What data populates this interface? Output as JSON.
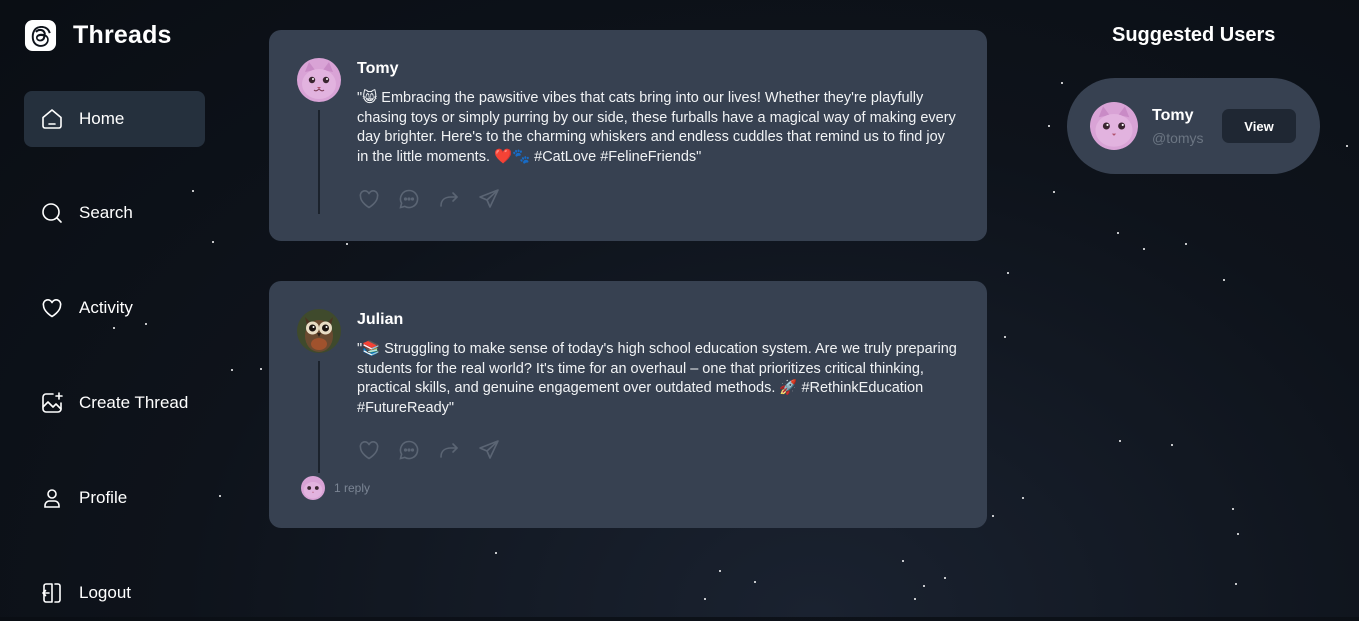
{
  "app": {
    "title": "Threads"
  },
  "nav": {
    "items": [
      {
        "label": "Home",
        "icon": "home-icon",
        "active": true
      },
      {
        "label": "Search",
        "icon": "search-icon"
      },
      {
        "label": "Activity",
        "icon": "heart-icon"
      },
      {
        "label": "Create Thread",
        "icon": "create-thread-icon"
      },
      {
        "label": "Profile",
        "icon": "user-icon"
      },
      {
        "label": "Logout",
        "icon": "logout-icon"
      }
    ]
  },
  "threads": [
    {
      "author": "Tomy",
      "content": "\"😸 Embracing the pawsitive vibes that cats bring into our lives! Whether they're playfully chasing toys or simply purring by our side, these furballs have a magical way of making every day brighter. Here's to the charming whiskers and endless cuddles that remind us to find joy in the little moments. ❤️🐾 #CatLove #FelineFriends\"",
      "avatar": "cat-avatar"
    },
    {
      "author": "Julian",
      "content": "\"📚 Struggling to make sense of today's high school education system. Are we truly preparing students for the real world? It's time for an overhaul – one that prioritizes critical thinking, practical skills, and genuine engagement over outdated methods. 🚀 #RethinkEducation #FutureReady\"",
      "avatar": "owl-avatar",
      "replies_label": "1 reply"
    }
  ],
  "suggested": {
    "title": "Suggested Users",
    "users": [
      {
        "name": "Tomy",
        "handle": "@tomys",
        "button_label": "View"
      }
    ]
  },
  "colors": {
    "background": "#0e131b",
    "card": "#374151",
    "active_nav": "#25303d",
    "muted_text": "#6b7582"
  }
}
